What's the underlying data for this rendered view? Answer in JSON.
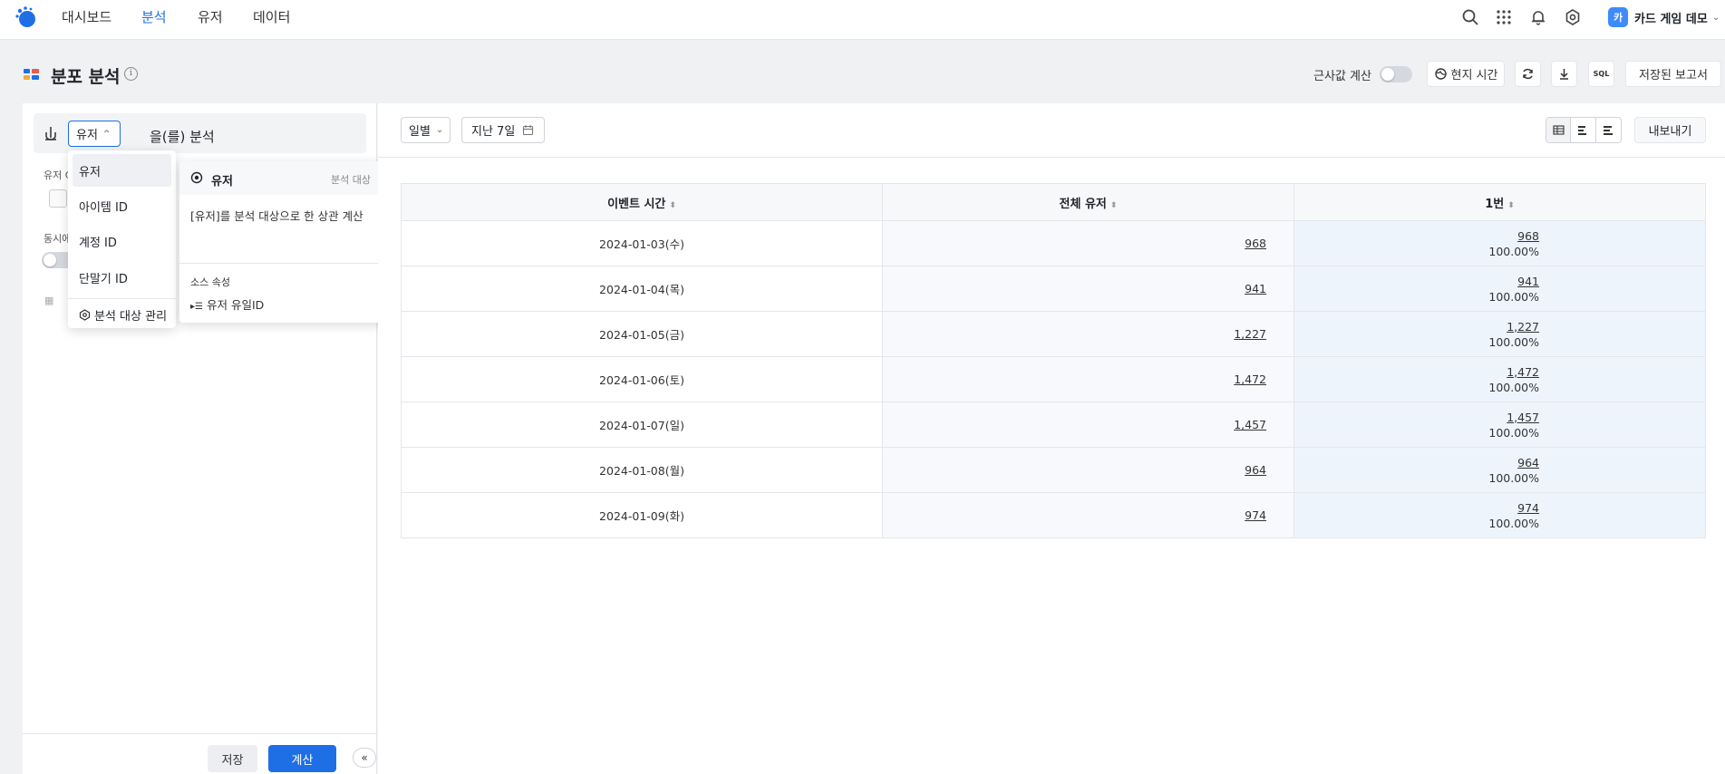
{
  "nav": {
    "tabs": [
      {
        "label": "대시보드"
      },
      {
        "label": "분석"
      },
      {
        "label": "유저"
      },
      {
        "label": "데이터"
      }
    ],
    "project": {
      "badge": "카",
      "name": "카드 게임 데모"
    }
  },
  "header": {
    "title": "분포 분석",
    "approx_label": "근사값 계산",
    "local_time": "현지 시간",
    "sql_label": "SQL",
    "saved_reports": "저장된 보고서"
  },
  "left": {
    "target_value": "유저",
    "suffix": "을(를) 분석",
    "label_user": "유저 C",
    "label_concurrent": "동시에",
    "save": "저장",
    "calculate": "계산",
    "collapse": "«"
  },
  "dropdown": {
    "items": [
      "유저",
      "아이템 ID",
      "계정 ID",
      "단말기 ID"
    ],
    "manage": "분석 대상 관리"
  },
  "detail": {
    "title": "유저",
    "tag": "분석 대상",
    "desc": "[유저]를 분석 대상으로 한 상관 계산",
    "source_label": "소스 속성",
    "source_value": "유저 유일ID"
  },
  "toolbar": {
    "period": "일별",
    "date_range": "지난 7일",
    "export": "내보내기"
  },
  "table": {
    "headers": [
      "이벤트 시간",
      "전체 유저",
      "1번"
    ],
    "rows": [
      {
        "date": "2024-01-03(수)",
        "total": "968",
        "count": "968",
        "pct": "100.00%"
      },
      {
        "date": "2024-01-04(목)",
        "total": "941",
        "count": "941",
        "pct": "100.00%"
      },
      {
        "date": "2024-01-05(금)",
        "total": "1,227",
        "count": "1,227",
        "pct": "100.00%"
      },
      {
        "date": "2024-01-06(토)",
        "total": "1,472",
        "count": "1,472",
        "pct": "100.00%"
      },
      {
        "date": "2024-01-07(일)",
        "total": "1,457",
        "count": "1,457",
        "pct": "100.00%"
      },
      {
        "date": "2024-01-08(월)",
        "total": "964",
        "count": "964",
        "pct": "100.00%"
      },
      {
        "date": "2024-01-09(화)",
        "total": "974",
        "count": "974",
        "pct": "100.00%"
      }
    ]
  },
  "colors": {
    "accent": "#1e6fe6",
    "brand_badge": "#3d8bfd"
  }
}
